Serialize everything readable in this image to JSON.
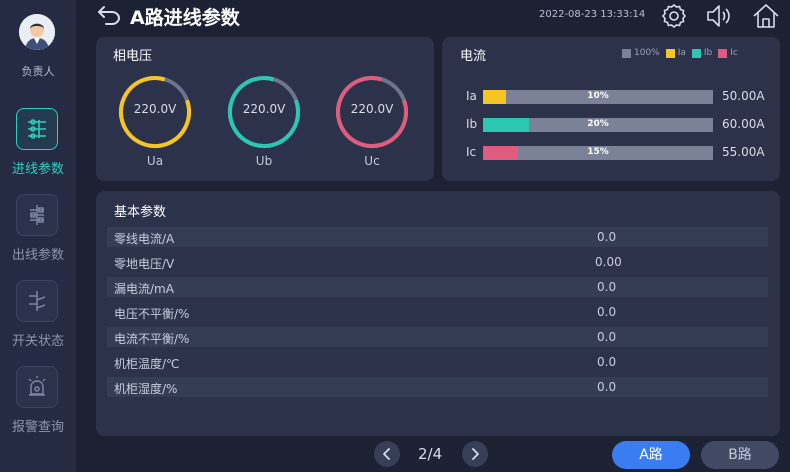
{
  "header": {
    "title": "A路进线参数",
    "datetime": "2022-08-23 13:33:14"
  },
  "sidebar": {
    "owner_label": "负责人",
    "items": [
      {
        "label": "进线参数",
        "icon": "incoming-line-icon",
        "active": true
      },
      {
        "label": "出线参数",
        "icon": "outgoing-line-icon",
        "active": false
      },
      {
        "label": "开关状态",
        "icon": "switch-status-icon",
        "active": false
      },
      {
        "label": "报警查询",
        "icon": "alarm-icon",
        "active": false
      }
    ]
  },
  "phase_voltage": {
    "title": "相电压",
    "gauges": [
      {
        "label": "Ua",
        "value": "220.0V",
        "color": "#f5c525"
      },
      {
        "label": "Ub",
        "value": "220.0V",
        "color": "#2cc7b0"
      },
      {
        "label": "Uc",
        "value": "220.0V",
        "color": "#e05c7e"
      }
    ]
  },
  "current": {
    "title": "电流",
    "legend": [
      {
        "label": "100%",
        "color": "#7b8196"
      },
      {
        "label": "Ia",
        "color": "#f5c525"
      },
      {
        "label": "Ib",
        "color": "#2cc7b0"
      },
      {
        "label": "Ic",
        "color": "#e05c7e"
      }
    ],
    "bars": [
      {
        "label": "Ia",
        "percent_text": "10%",
        "fraction": 0.1,
        "value": "50.00A",
        "color": "#f5c525"
      },
      {
        "label": "Ib",
        "percent_text": "20%",
        "fraction": 0.2,
        "value": "60.00A",
        "color": "#2cc7b0"
      },
      {
        "label": "Ic",
        "percent_text": "15%",
        "fraction": 0.15,
        "value": "55.00A",
        "color": "#e05c7e"
      }
    ]
  },
  "basic_params": {
    "title": "基本参数",
    "rows": [
      {
        "label": "零线电流/A",
        "value": "0.0"
      },
      {
        "label": "零地电压/V",
        "value": "0.00"
      },
      {
        "label": "漏电流/mA",
        "value": "0.0"
      },
      {
        "label": "电压不平衡/%",
        "value": "0.0"
      },
      {
        "label": "电流不平衡/%",
        "value": "0.0"
      },
      {
        "label": "机柜温度/℃",
        "value": "0.0"
      },
      {
        "label": "机柜湿度/%",
        "value": "0.0"
      }
    ]
  },
  "pager": {
    "text": "2/4"
  },
  "routes": {
    "a_label": "A路",
    "b_label": "B路"
  },
  "icons": {
    "back": "back-arrow-icon",
    "settings": "gear-icon",
    "sound": "speaker-icon",
    "home": "home-icon",
    "prev": "chevron-left-icon",
    "next": "chevron-right-icon"
  }
}
